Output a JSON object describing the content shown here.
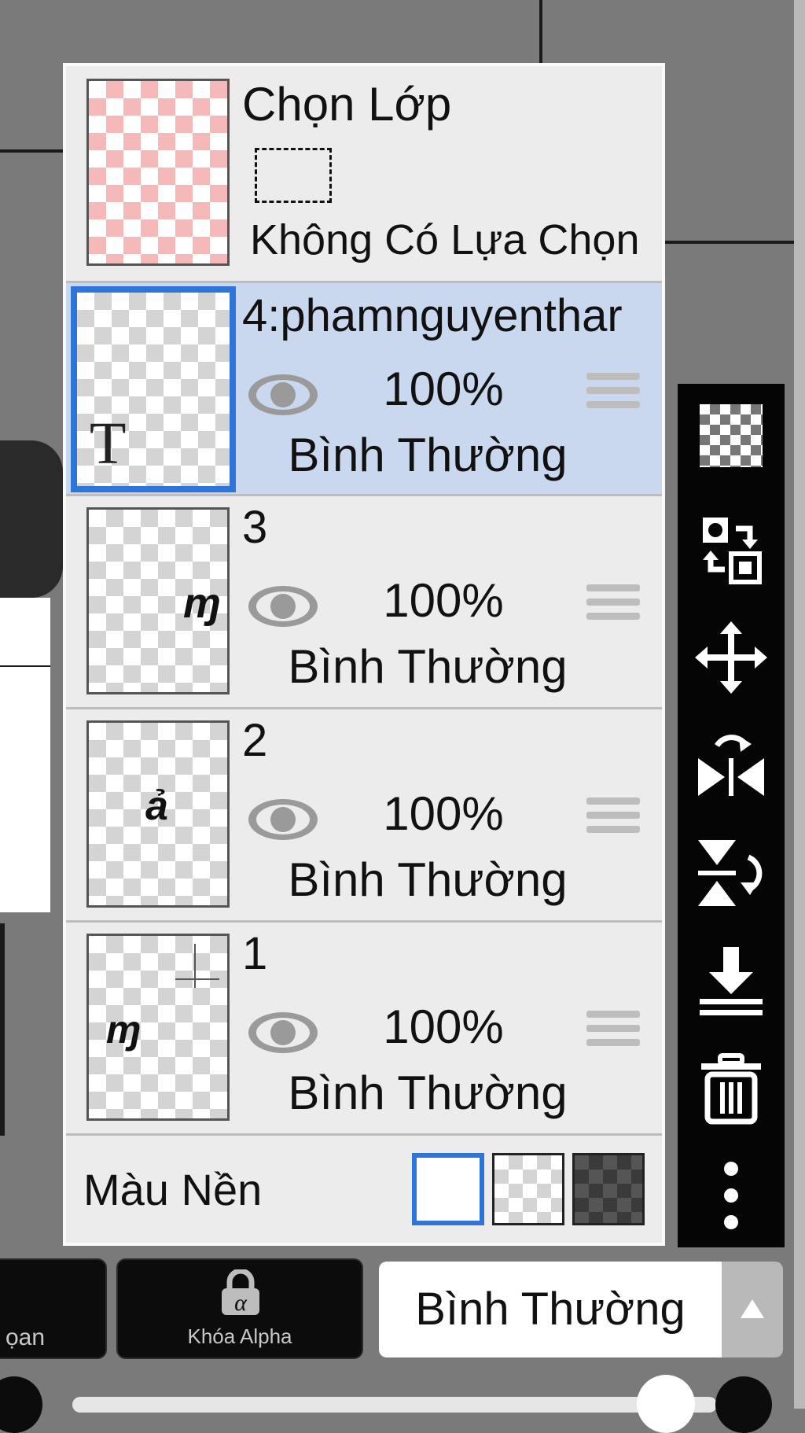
{
  "selection_row": {
    "title": "Chọn Lớp",
    "status": "Không Có Lựa Chọn"
  },
  "layers": [
    {
      "name": "4:phamnguyenthar",
      "opacity": "100%",
      "mode": "Bình Thường",
      "selected": true,
      "thumb_glyph": "T"
    },
    {
      "name": "3",
      "opacity": "100%",
      "mode": "Bình Thường",
      "selected": false
    },
    {
      "name": "2",
      "opacity": "100%",
      "mode": "Bình Thường",
      "selected": false
    },
    {
      "name": "1",
      "opacity": "100%",
      "mode": "Bình Thường",
      "selected": false
    }
  ],
  "background_row": {
    "label": "Màu Nền",
    "options": [
      "white",
      "transparent",
      "dark-checker"
    ],
    "selected": "white"
  },
  "toolbar": {
    "tools": [
      "transparency-icon",
      "swap-layers-icon",
      "move-icon",
      "flip-horizontal-icon",
      "flip-vertical-icon",
      "merge-down-icon",
      "trash-icon",
      "more-vert-icon"
    ]
  },
  "bottom_bar": {
    "clip_label_partial": "ọan",
    "alpha_lock_label": "Khóa Alpha",
    "blend_mode": "Bình Thường"
  },
  "colors": {
    "accent": "#2f74d8",
    "selected_row": "#c9d8ee",
    "panel_bg": "#ececec",
    "toolbar_bg": "#050505"
  }
}
